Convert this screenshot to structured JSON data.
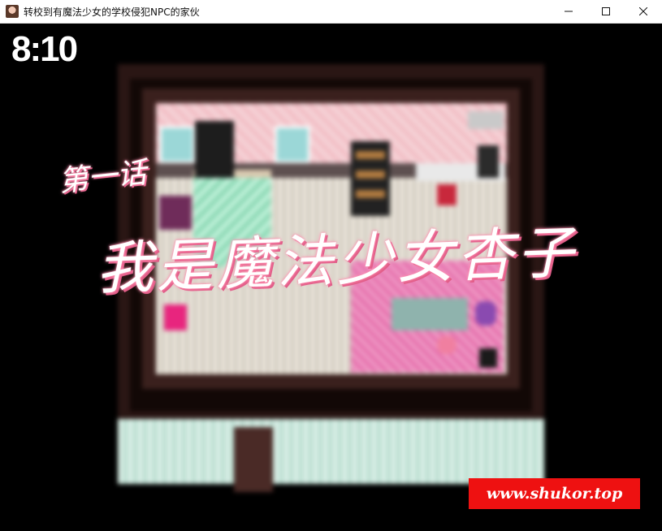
{
  "window": {
    "title": "转校到有魔法少女的学校侵犯NPC的家伙",
    "icon": "app-portrait-icon",
    "controls": [
      "minimize",
      "maximize",
      "close"
    ]
  },
  "game": {
    "clock": "8:10",
    "chapter_number": "第一话",
    "chapter_title": "我是魔法少女杏子",
    "scene": "blurred-bedroom-map",
    "watermark": "www.shukor.top"
  },
  "colors": {
    "titlebar_bg": "#ffffff",
    "game_bg": "#000000",
    "overlay_text": "#ffffff",
    "overlay_glow": "#ff8fb0",
    "watermark_bg": "#ee1111"
  }
}
